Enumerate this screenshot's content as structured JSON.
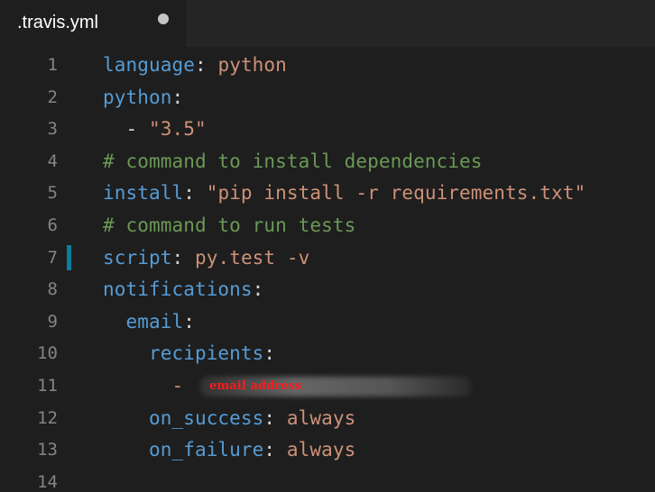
{
  "tab": {
    "filename": ".travis.yml",
    "unsaved_indicator": "unsaved-dot"
  },
  "editor": {
    "modified_line": 7,
    "lines": [
      {
        "n": "1",
        "tokens": [
          {
            "t": "language",
            "c": "k"
          },
          {
            "t": ": ",
            "c": "p"
          },
          {
            "t": "python",
            "c": "s"
          }
        ]
      },
      {
        "n": "2",
        "tokens": [
          {
            "t": "python",
            "c": "k"
          },
          {
            "t": ":",
            "c": "p"
          }
        ]
      },
      {
        "n": "3",
        "tokens": [
          {
            "t": "  - ",
            "c": "p"
          },
          {
            "t": "\"3.5\"",
            "c": "s"
          }
        ]
      },
      {
        "n": "4",
        "tokens": [
          {
            "t": "# command to install dependencies",
            "c": "c"
          }
        ]
      },
      {
        "n": "5",
        "tokens": [
          {
            "t": "install",
            "c": "k"
          },
          {
            "t": ": ",
            "c": "p"
          },
          {
            "t": "\"pip install -r requirements.txt\"",
            "c": "s"
          }
        ]
      },
      {
        "n": "6",
        "tokens": [
          {
            "t": "# command to run tests",
            "c": "c"
          }
        ]
      },
      {
        "n": "7",
        "tokens": [
          {
            "t": "script",
            "c": "k"
          },
          {
            "t": ": ",
            "c": "p"
          },
          {
            "t": "py.test -v",
            "c": "s"
          }
        ]
      },
      {
        "n": "8",
        "tokens": [
          {
            "t": "notifications",
            "c": "k"
          },
          {
            "t": ":",
            "c": "p"
          }
        ]
      },
      {
        "n": "9",
        "tokens": [
          {
            "t": "  email",
            "c": "k"
          },
          {
            "t": ":",
            "c": "p"
          }
        ]
      },
      {
        "n": "10",
        "tokens": [
          {
            "t": "    recipients",
            "c": "k"
          },
          {
            "t": ":",
            "c": "p"
          }
        ]
      },
      {
        "n": "11",
        "tokens": [
          {
            "t": "      - ",
            "c": "s"
          }
        ],
        "redacted": true,
        "redaction_label": "email address"
      },
      {
        "n": "12",
        "tokens": [
          {
            "t": "    on_success",
            "c": "k"
          },
          {
            "t": ": ",
            "c": "p"
          },
          {
            "t": "always",
            "c": "s"
          }
        ]
      },
      {
        "n": "13",
        "tokens": [
          {
            "t": "    on_failure",
            "c": "k"
          },
          {
            "t": ": ",
            "c": "p"
          },
          {
            "t": "always",
            "c": "s"
          }
        ]
      },
      {
        "n": "14",
        "tokens": []
      }
    ]
  },
  "colors": {
    "background": "#1e1e1e",
    "keyword": "#569cd6",
    "string": "#ce9178",
    "comment": "#6a9955",
    "line_number": "#858585",
    "modified_gutter": "#0c7d9d",
    "redaction_text": "#ff1a1a"
  }
}
